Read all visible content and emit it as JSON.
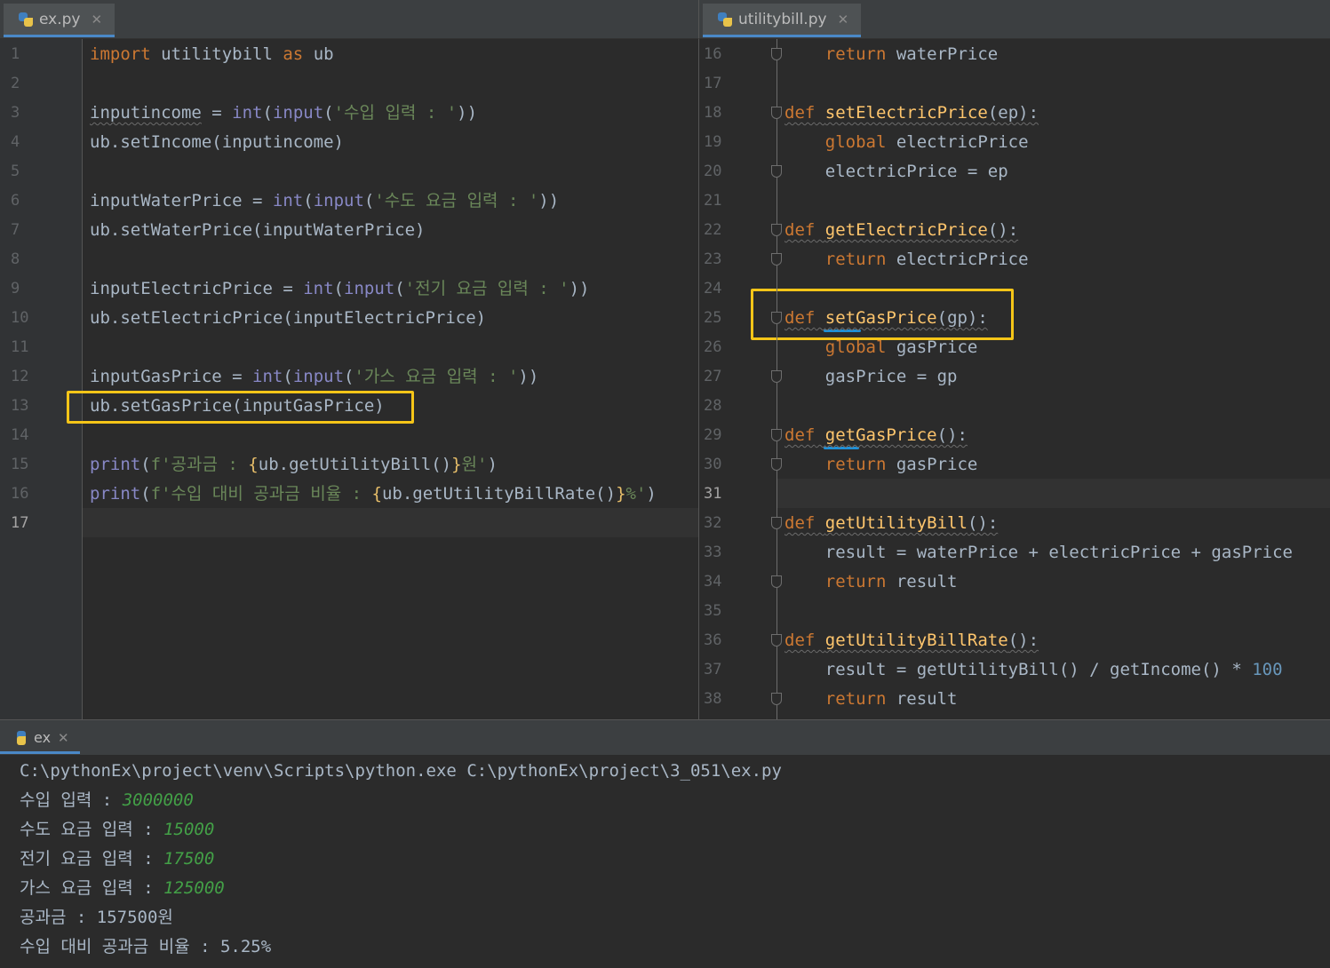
{
  "left_tab": {
    "label": "ex.py",
    "icon": "python-file-icon"
  },
  "right_tab": {
    "label": "utilitybill.py",
    "icon": "python-file-icon"
  },
  "left_lines": [
    {
      "n": "1",
      "html": "<span class='kw'>import</span> utilitybill <span class='kw'>as</span> ub"
    },
    {
      "n": "2",
      "html": ""
    },
    {
      "n": "3",
      "html": "<span class='wavy'>inputincome</span> = <span class='bi'>int</span>(<span class='bi'>input</span>(<span class='str'>'수입 입력 : '</span>))"
    },
    {
      "n": "4",
      "html": "ub.setIncome(inputincome)"
    },
    {
      "n": "5",
      "html": ""
    },
    {
      "n": "6",
      "html": "inputWaterPrice = <span class='bi'>int</span>(<span class='bi'>input</span>(<span class='str'>'수도 요금 입력 : '</span>))"
    },
    {
      "n": "7",
      "html": "ub.setWaterPrice(inputWaterPrice)"
    },
    {
      "n": "8",
      "html": ""
    },
    {
      "n": "9",
      "html": "inputElectricPrice = <span class='bi'>int</span>(<span class='bi'>input</span>(<span class='str'>'전기 요금 입력 : '</span>))"
    },
    {
      "n": "10",
      "html": "ub.setElectricPrice(inputElectricPrice)"
    },
    {
      "n": "11",
      "html": ""
    },
    {
      "n": "12",
      "html": "inputGasPrice = <span class='bi'>int</span>(<span class='bi'>input</span>(<span class='str'>'가스 요금 입력 : '</span>))"
    },
    {
      "n": "13",
      "html": "ub.setGasPrice(inputGasPrice)"
    },
    {
      "n": "14",
      "html": ""
    },
    {
      "n": "15",
      "html": "<span class='bi'>print</span>(<span class='str'>f'공과금 : </span><span class='br'>{</span>ub.getUtilityBill()<span class='br'>}</span><span class='str'>원'</span>)"
    },
    {
      "n": "16",
      "html": "<span class='bi'>print</span>(<span class='str'>f'수입 대비 공과금 비율 : </span><span class='br'>{</span>ub.getUtilityBillRate()<span class='br'>}</span><span class='str'>%'</span>)"
    },
    {
      "n": "17",
      "html": ""
    }
  ],
  "right_lines": [
    {
      "n": "16",
      "html": "    <span class='kw'>return</span> waterPrice"
    },
    {
      "n": "17",
      "html": ""
    },
    {
      "n": "18",
      "html": "<span class='wavy'><span class='kw'>def</span> <span class='fn'>setElectricPrice</span>(ep):</span>"
    },
    {
      "n": "19",
      "html": "    <span class='kw'>global</span> electricPrice"
    },
    {
      "n": "20",
      "html": "    electricPrice = ep"
    },
    {
      "n": "21",
      "html": ""
    },
    {
      "n": "22",
      "html": "<span class='wavy'><span class='kw'>def</span> <span class='fn'>getElectricPrice</span>():</span>"
    },
    {
      "n": "23",
      "html": "    <span class='kw'>return</span> electricPrice"
    },
    {
      "n": "24",
      "html": ""
    },
    {
      "n": "25",
      "html": "<span class='wavy'><span class='kw'>def</span> <span class='fn'>setGasPrice</span>(gp):</span>"
    },
    {
      "n": "26",
      "html": "    <span class='kw'>global</span> gasPrice"
    },
    {
      "n": "27",
      "html": "    gasPrice = gp"
    },
    {
      "n": "28",
      "html": ""
    },
    {
      "n": "29",
      "html": "<span class='wavy'><span class='kw'>def</span> <span class='fn'>getGasPrice</span>():</span>"
    },
    {
      "n": "30",
      "html": "    <span class='kw'>return</span> gasPrice"
    },
    {
      "n": "31",
      "html": ""
    },
    {
      "n": "32",
      "html": "<span class='wavy'><span class='kw'>def</span> <span class='fn'>getUtilityBill</span>():</span>"
    },
    {
      "n": "33",
      "html": "    result = waterPrice + electricPrice + gasPrice"
    },
    {
      "n": "34",
      "html": "    <span class='kw'>return</span> result"
    },
    {
      "n": "35",
      "html": ""
    },
    {
      "n": "36",
      "html": "<span class='wavy'><span class='kw'>def</span> <span class='fn'>getUtilityBillRate</span>():</span>"
    },
    {
      "n": "37",
      "html": "    result = getUtilityBill() / getIncome() * <span class='num'>100</span>"
    },
    {
      "n": "38",
      "html": "    <span class='kw'>return</span> result"
    }
  ],
  "run": {
    "tab_label": "ex",
    "command": "C:\\pythonEx\\project\\venv\\Scripts\\python.exe C:\\pythonEx\\project\\3_051\\ex.py",
    "prompts": [
      {
        "prompt": "수입 입력 : ",
        "input": "3000000"
      },
      {
        "prompt": "수도 요금 입력 : ",
        "input": "15000"
      },
      {
        "prompt": "전기 요금 입력 : ",
        "input": "17500"
      },
      {
        "prompt": "가스 요금 입력 : ",
        "input": "125000"
      }
    ],
    "results": [
      "공과금 : 157500원",
      "수입 대비 공과금 비율 : 5.25%"
    ]
  },
  "colors": {
    "highlight_box": "#f5c518",
    "keyword": "#cc7832",
    "function": "#ffc66d",
    "string": "#6a8759",
    "console_input": "#43a047"
  }
}
